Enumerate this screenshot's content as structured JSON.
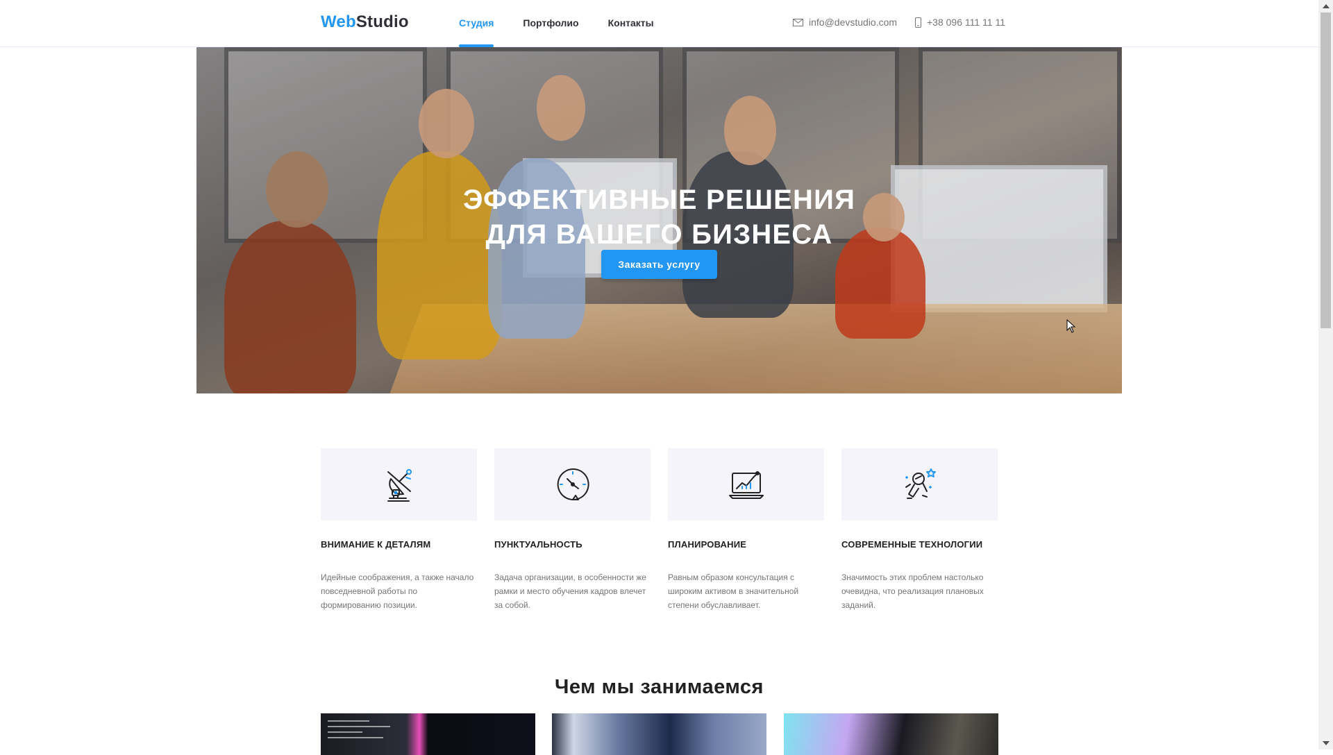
{
  "header": {
    "logo_part1": "Web",
    "logo_part2": "Studio",
    "nav": [
      {
        "label": "Студия",
        "active": true
      },
      {
        "label": "Портфолио",
        "active": false
      },
      {
        "label": "Контакты",
        "active": false
      }
    ],
    "email": "info@devstudio.com",
    "phone": "+38 096 111 11 11"
  },
  "hero": {
    "title_line1": "Эффективные решения",
    "title_line2": "для вашего бизнеса",
    "button_label": "Заказать услугу"
  },
  "features": [
    {
      "icon": "antenna-icon",
      "title": "ВНИМАНИЕ К ДЕТАЛЯМ",
      "text": "Идейные соображения, а также начало повседневной работы по формированию позиции."
    },
    {
      "icon": "clock-icon",
      "title": "ПУНКТУАЛЬНОСТЬ",
      "text": "Задача организации, в особенности же рамки и место обучения кадров влечет за собой."
    },
    {
      "icon": "laptop-chart-icon",
      "title": "ПЛАНИРОВАНИЕ",
      "text": "Равным образом консультация с широким активом в значительной степени обуславливает."
    },
    {
      "icon": "astronaut-icon",
      "title": "СОВРЕМЕННЫЕ ТЕХНОЛОГИИ",
      "text": "Значимость этих проблем настолько очевидна, что реализация плановых заданий."
    }
  ],
  "section": {
    "title": "Чем мы занимаемся"
  },
  "colors": {
    "accent": "#2196f3",
    "text_dark": "#212121",
    "text_muted": "#757575",
    "icon_bg": "#f5f4fa"
  }
}
